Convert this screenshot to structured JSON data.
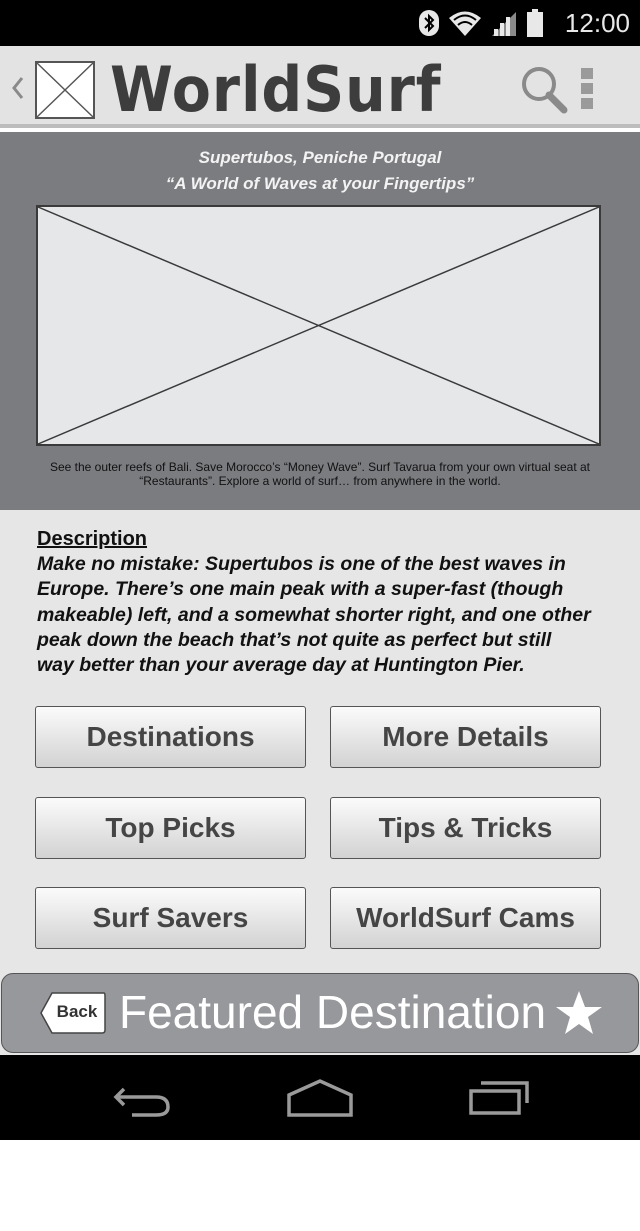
{
  "status_bar": {
    "time": "12:00",
    "icons": [
      "bluetooth-icon",
      "wifi-icon",
      "signal-icon",
      "battery-icon"
    ]
  },
  "action_bar": {
    "title": "WorldSurf",
    "icons": [
      "up-chevron-icon",
      "app-logo-placeholder",
      "search-icon",
      "overflow-menu-icon"
    ]
  },
  "hero": {
    "location": "Supertubos, Peniche Portugal",
    "tagline": "“A World of Waves at your Fingertips”",
    "caption_line1": "See the outer reefs of Bali. Save Morocco’s “Money Wave”. Surf Tavarua from your own virtual seat at",
    "caption_line2": "“Restaurants”. Explore a world of surf… from anywhere in the world."
  },
  "description": {
    "heading": "Description",
    "lines": [
      "Make no mistake: Supertubos is one of the best waves in",
      "Europe. There’s one main peak with a super-fast (though",
      "makeable) left, and a somewhat shorter right, and one other",
      "peak down the beach that’s not quite as perfect but still",
      "way better than your average day at Huntington Pier."
    ]
  },
  "buttons": {
    "destinations": "Destinations",
    "more_details": "More Details",
    "top_picks": "Top Picks",
    "tips_tricks": "Tips & Tricks",
    "surf_savers": "Surf Savers",
    "worldsurf_cams": "WorldSurf Cams"
  },
  "featured": {
    "back_label": "Back",
    "title": "Featured Destination"
  },
  "nav_bar": {
    "icons": [
      "back-nav-icon",
      "home-nav-icon",
      "recent-apps-icon"
    ]
  },
  "colors": {
    "hero_background": "#7b7c80",
    "content_background": "#e6e6e6",
    "featured_background": "#97989c",
    "system_bars": "#000000"
  }
}
